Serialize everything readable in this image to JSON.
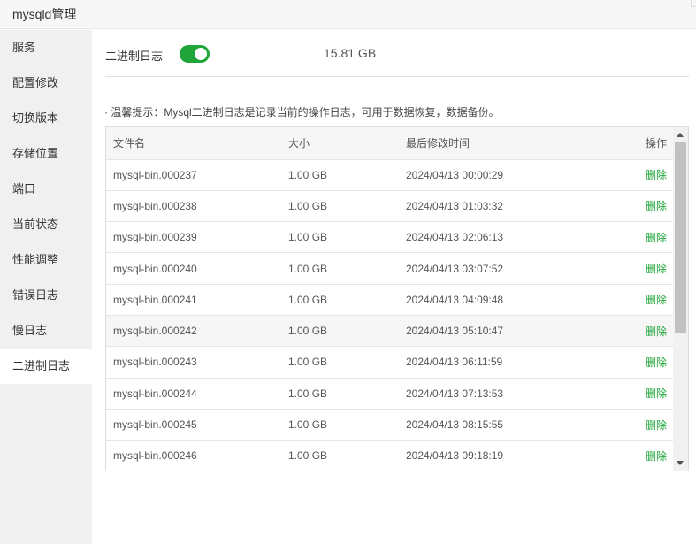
{
  "window": {
    "title": "mysqld管理"
  },
  "sidebar": {
    "items": [
      {
        "label": "服务"
      },
      {
        "label": "配置修改"
      },
      {
        "label": "切换版本"
      },
      {
        "label": "存储位置"
      },
      {
        "label": "端口"
      },
      {
        "label": "当前状态"
      },
      {
        "label": "性能调整"
      },
      {
        "label": "错误日志"
      },
      {
        "label": "慢日志"
      },
      {
        "label": "二进制日志"
      }
    ],
    "active_index": 9
  },
  "binlog": {
    "label": "二进制日志",
    "enabled": true,
    "total_size": "15.81 GB",
    "tip": "· 温馨提示：Mysql二进制日志是记录当前的操作日志，可用于数据恢复，数据备份。"
  },
  "table": {
    "headers": [
      "文件名",
      "大小",
      "最后修改时间",
      "操作"
    ],
    "rows": [
      {
        "name": "mysql-bin.000237",
        "size": "1.00 GB",
        "mtime": "2024/04/13 00:00:29",
        "action": "删除"
      },
      {
        "name": "mysql-bin.000238",
        "size": "1.00 GB",
        "mtime": "2024/04/13 01:03:32",
        "action": "删除"
      },
      {
        "name": "mysql-bin.000239",
        "size": "1.00 GB",
        "mtime": "2024/04/13 02:06:13",
        "action": "删除"
      },
      {
        "name": "mysql-bin.000240",
        "size": "1.00 GB",
        "mtime": "2024/04/13 03:07:52",
        "action": "删除"
      },
      {
        "name": "mysql-bin.000241",
        "size": "1.00 GB",
        "mtime": "2024/04/13 04:09:48",
        "action": "删除"
      },
      {
        "name": "mysql-bin.000242",
        "size": "1.00 GB",
        "mtime": "2024/04/13 05:10:47",
        "action": "删除"
      },
      {
        "name": "mysql-bin.000243",
        "size": "1.00 GB",
        "mtime": "2024/04/13 06:11:59",
        "action": "删除"
      },
      {
        "name": "mysql-bin.000244",
        "size": "1.00 GB",
        "mtime": "2024/04/13 07:13:53",
        "action": "删除"
      },
      {
        "name": "mysql-bin.000245",
        "size": "1.00 GB",
        "mtime": "2024/04/13 08:15:55",
        "action": "删除"
      },
      {
        "name": "mysql-bin.000246",
        "size": "1.00 GB",
        "mtime": "2024/04/13 09:18:19",
        "action": "删除"
      }
    ],
    "highlighted_index": 5
  },
  "colors": {
    "accent": "#20a53a"
  }
}
